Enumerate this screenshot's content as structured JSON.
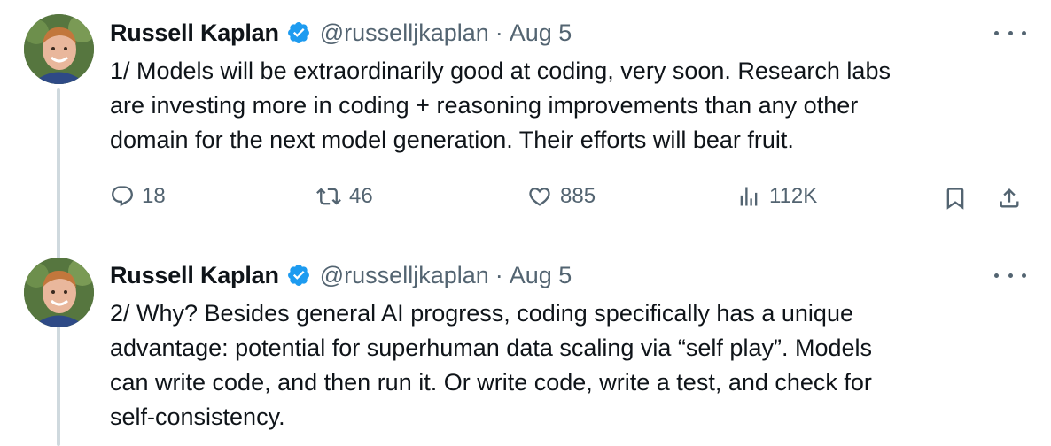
{
  "tweets": [
    {
      "author_name": "Russell Kaplan",
      "handle": "@russelljkaplan",
      "separator": "·",
      "time": "Aug 5",
      "text": "1/ Models will be extraordinarily good at coding, very soon. Research labs\nare investing more in coding + reasoning improvements than any other\ndomain for the next model generation. Their efforts will bear fruit.",
      "stats": {
        "replies": "18",
        "reposts": "46",
        "likes": "885",
        "views": "112K"
      }
    },
    {
      "author_name": "Russell Kaplan",
      "handle": "@russelljkaplan",
      "separator": "·",
      "time": "Aug 5",
      "text": "2/ Why? Besides general AI progress, coding specifically has a unique\nadvantage: potential for superhuman data scaling via “self play”. Models\ncan write code, and then run it. Or write code, write a test, and check for\nself-consistency."
    }
  ],
  "icons": {
    "verified": "verified-badge-icon",
    "more": "more-options-icon",
    "reply": "reply-icon",
    "repost": "repost-icon",
    "like": "like-icon",
    "views": "views-icon",
    "bookmark": "bookmark-icon",
    "share": "share-icon"
  },
  "colors": {
    "verified": "#1d9bf0",
    "secondary_text": "#536471",
    "thread_line": "#cfd9de"
  }
}
